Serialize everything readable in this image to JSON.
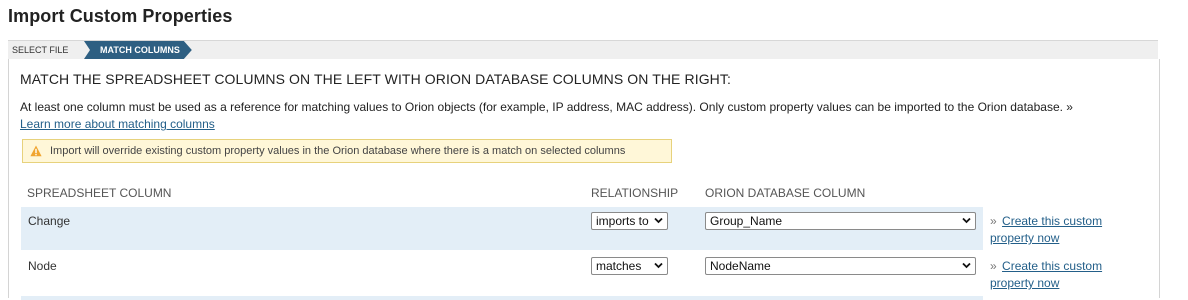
{
  "page": {
    "title": "Import Custom Properties"
  },
  "wizard": {
    "steps": [
      {
        "label": "SELECT FILE"
      },
      {
        "label": "MATCH COLUMNS"
      }
    ]
  },
  "main": {
    "heading": "MATCH THE SPREADSHEET COLUMNS ON THE LEFT WITH ORION DATABASE COLUMNS ON THE RIGHT:",
    "description": "At least one column must be used as a reference for matching values to Orion objects (for example, IP address, MAC address). Only custom property values can be imported to the Orion database. »",
    "learn_more_link": "Learn more about matching columns",
    "warning": "Import will override existing custom property values in the Orion database where there is a match on selected columns",
    "columns": {
      "spreadsheet": "SPREADSHEET COLUMN",
      "relationship": "RELATIONSHIP",
      "orion": "ORION DATABASE COLUMN"
    },
    "rows": [
      {
        "spreadsheet": "Change",
        "relationship": "imports to",
        "orion": "Group_Name",
        "create_link_1": "Create this custom",
        "create_link_2": "property now"
      },
      {
        "spreadsheet": "Node",
        "relationship": "matches",
        "orion": "NodeName",
        "create_link_1": "Create this custom",
        "create_link_2": "property now"
      }
    ]
  },
  "colors": {
    "accent": "#2e5f82",
    "link": "#235f89",
    "row_highlight": "#e3eef7",
    "warning_bg": "#fff7d8"
  }
}
